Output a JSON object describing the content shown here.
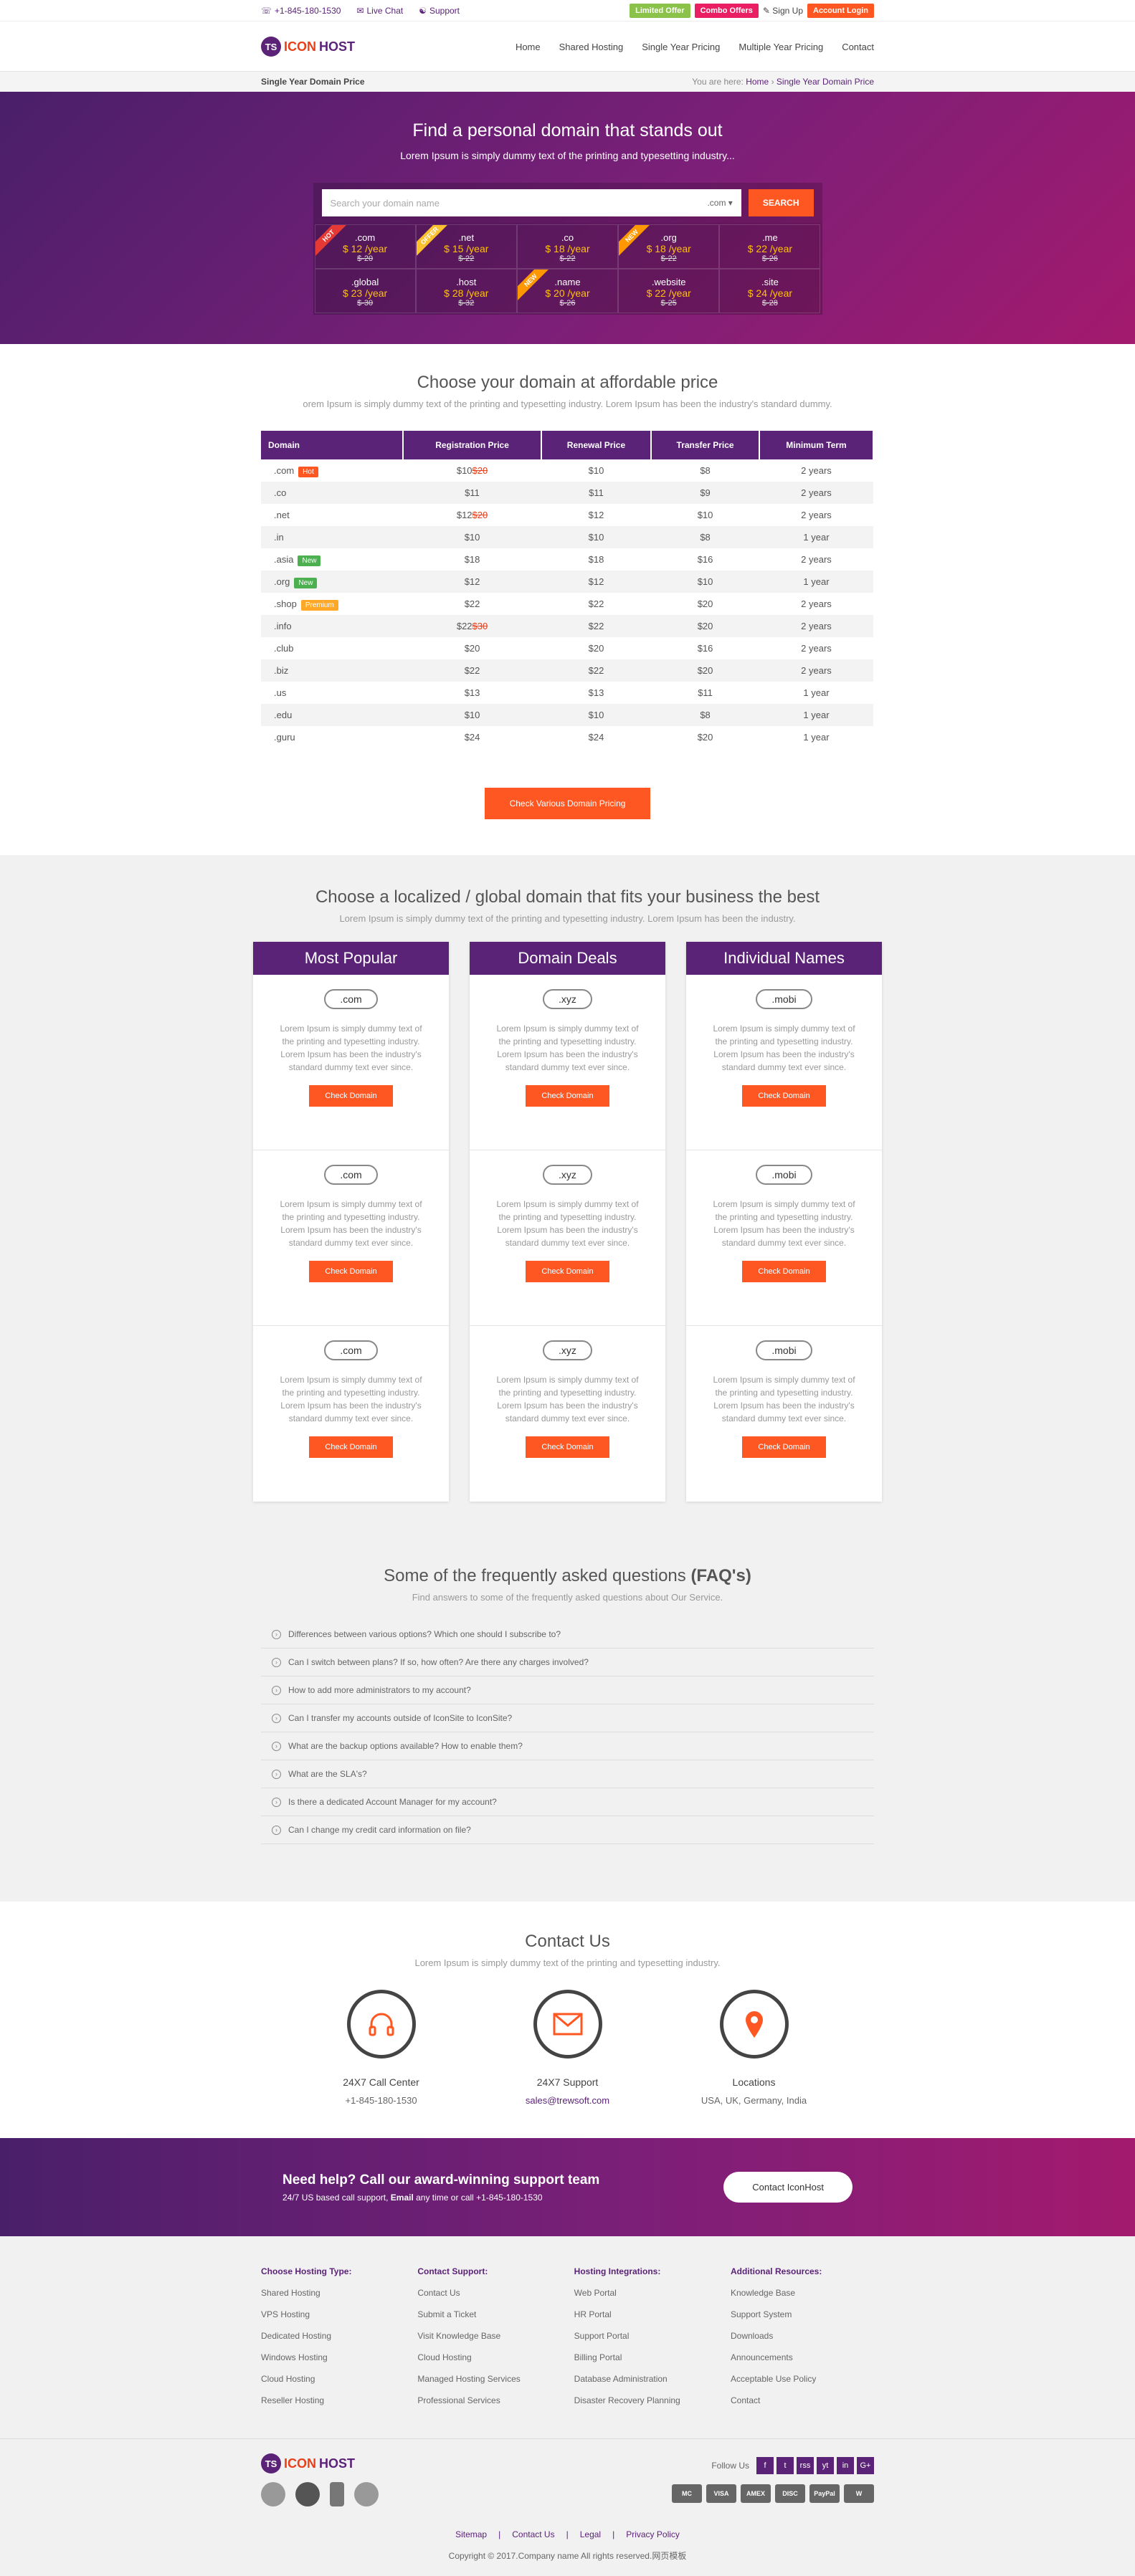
{
  "topbar": {
    "phone": "+1-845-180-1530",
    "live_chat": "Live Chat",
    "support": "Support",
    "limited_offer": "Limited Offer",
    "combo_offers": "Combo Offers",
    "sign_up": "Sign Up",
    "account_login": "Account Login"
  },
  "logo": {
    "mark": "TS",
    "part1": "ICON",
    "part2": "HOST"
  },
  "nav": [
    "Home",
    "Shared Hosting",
    "Single Year Pricing",
    "Multiple Year Pricing",
    "Contact"
  ],
  "crumb": {
    "title": "Single Year Domain Price",
    "prefix": "You are here:",
    "home": "Home",
    "sep": "›",
    "current": "Single Year Domain Price"
  },
  "hero": {
    "title": "Find a personal domain that stands out",
    "subtitle": "Lorem Ipsum is simply dummy text of the printing and typesetting industry...",
    "placeholder": "Search your domain name",
    "tld": ".com",
    "search": "SEARCH",
    "tlds": [
      {
        "name": ".com",
        "price": "$ 12 /year",
        "old": "$-20",
        "ribbon": "HOT"
      },
      {
        "name": ".net",
        "price": "$ 15 /year",
        "old": "$-22",
        "ribbon": "OFFER"
      },
      {
        "name": ".co",
        "price": "$ 18 /year",
        "old": "$-22",
        "ribbon": ""
      },
      {
        "name": ".org",
        "price": "$ 18 /year",
        "old": "$-22",
        "ribbon": "NEW"
      },
      {
        "name": ".me",
        "price": "$ 22 /year",
        "old": "$-26",
        "ribbon": ""
      },
      {
        "name": ".global",
        "price": "$ 23 /year",
        "old": "$-30",
        "ribbon": ""
      },
      {
        "name": ".host",
        "price": "$ 28 /year",
        "old": "$-32",
        "ribbon": ""
      },
      {
        "name": ".name",
        "price": "$ 20 /year",
        "old": "$-26",
        "ribbon": "NEW"
      },
      {
        "name": ".website",
        "price": "$ 22 /year",
        "old": "$-25",
        "ribbon": ""
      },
      {
        "name": ".site",
        "price": "$ 24 /year",
        "old": "$-28",
        "ribbon": ""
      }
    ]
  },
  "pricing": {
    "title": "Choose your domain at affordable price",
    "subtitle": "orem Ipsum is simply dummy text of the printing and typesetting industry. Lorem Ipsum has been the industry's standard dummy.",
    "headers": [
      "Domain",
      "Registration Price",
      "Renewal Price",
      "Transfer Price",
      "Minimum Term"
    ],
    "rows": [
      {
        "domain": ".com",
        "badge": "Hot",
        "reg": "$10",
        "old": "$20",
        "renew": "$10",
        "transfer": "$8",
        "term": "2 years"
      },
      {
        "domain": ".co",
        "badge": "",
        "reg": "$11",
        "old": "",
        "renew": "$11",
        "transfer": "$9",
        "term": "2 years"
      },
      {
        "domain": ".net",
        "badge": "",
        "reg": "$12",
        "old": "$20",
        "renew": "$12",
        "transfer": "$10",
        "term": "2 years"
      },
      {
        "domain": ".in",
        "badge": "",
        "reg": "$10",
        "old": "",
        "renew": "$10",
        "transfer": "$8",
        "term": "1 year"
      },
      {
        "domain": ".asia",
        "badge": "New",
        "reg": "$18",
        "old": "",
        "renew": "$18",
        "transfer": "$16",
        "term": "2 years"
      },
      {
        "domain": ".org",
        "badge": "New",
        "reg": "$12",
        "old": "",
        "renew": "$12",
        "transfer": "$10",
        "term": "1 year"
      },
      {
        "domain": ".shop",
        "badge": "Premium",
        "reg": "$22",
        "old": "",
        "renew": "$22",
        "transfer": "$20",
        "term": "2 years"
      },
      {
        "domain": ".info",
        "badge": "",
        "reg": "$22",
        "old": "$30",
        "renew": "$22",
        "transfer": "$20",
        "term": "2 years"
      },
      {
        "domain": ".club",
        "badge": "",
        "reg": "$20",
        "old": "",
        "renew": "$20",
        "transfer": "$16",
        "term": "2 years"
      },
      {
        "domain": ".biz",
        "badge": "",
        "reg": "$22",
        "old": "",
        "renew": "$22",
        "transfer": "$20",
        "term": "2 years"
      },
      {
        "domain": ".us",
        "badge": "",
        "reg": "$13",
        "old": "",
        "renew": "$13",
        "transfer": "$11",
        "term": "1 year"
      },
      {
        "domain": ".edu",
        "badge": "",
        "reg": "$10",
        "old": "",
        "renew": "$10",
        "transfer": "$8",
        "term": "1 year"
      },
      {
        "domain": ".guru",
        "badge": "",
        "reg": "$24",
        "old": "",
        "renew": "$24",
        "transfer": "$20",
        "term": "1 year"
      }
    ],
    "button": "Check Various Domain Pricing"
  },
  "localized": {
    "title": "Choose a localized / global domain that fits your business the best",
    "subtitle": "Lorem Ipsum is simply dummy text of the printing and typesetting industry. Lorem Ipsum has been the industry.",
    "columns": [
      {
        "title": "Most Popular",
        "tld": ".com"
      },
      {
        "title": "Domain Deals",
        "tld": ".xyz"
      },
      {
        "title": "Individual Names",
        "tld": ".mobi"
      }
    ],
    "text": "Lorem Ipsum is simply dummy text of the printing and typesetting industry. Lorem Ipsum has been the industry's standard dummy text ever since.",
    "button": "Check Domain"
  },
  "faq": {
    "title": "Some of the frequently asked questions",
    "title_bold": "(FAQ's)",
    "subtitle": "Find answers to some of the frequently asked questions about Our Service.",
    "questions": [
      "Differences between various options? Which one should I subscribe to?",
      "Can I switch between plans? If so, how often? Are there any charges involved?",
      "How to add more administrators to my account?",
      "Can I transfer my accounts outside of IconSite to IconSite?",
      "What are the backup options available? How to enable them?",
      "What are the SLA's?",
      "Is there a dedicated Account Manager for my account?",
      "Can I change my credit card information on file?"
    ]
  },
  "contact": {
    "title": "Contact Us",
    "subtitle": "Lorem Ipsum is simply dummy text of the printing and typesetting industry.",
    "items": [
      {
        "title": "24X7 Call Center",
        "value": "+1-845-180-1530",
        "icon": "headphones-icon"
      },
      {
        "title": "24X7 Support",
        "value": "sales@trewsoft.com",
        "icon": "envelope-icon"
      },
      {
        "title": "Locations",
        "value": "USA, UK, Germany, India",
        "icon": "map-pin-icon"
      }
    ]
  },
  "help": {
    "title": "Need help? Call our award-winning support team",
    "text_a": "24/7 US based call support,",
    "text_b": "Email",
    "text_c": "any time or call +1-845-180-1530",
    "button": "Contact IconHost"
  },
  "footer": {
    "cols": [
      {
        "title": "Choose Hosting Type:",
        "links": [
          "Shared Hosting",
          "VPS Hosting",
          "Dedicated Hosting",
          "Windows Hosting",
          "Cloud Hosting",
          "Reseller Hosting"
        ]
      },
      {
        "title": "Contact Support:",
        "links": [
          "Contact Us",
          "Submit a Ticket",
          "Visit Knowledge Base",
          "Cloud Hosting",
          "Managed Hosting Services",
          "Professional Services"
        ]
      },
      {
        "title": "Hosting Integrations:",
        "links": [
          "Web Portal",
          "HR Portal",
          "Support Portal",
          "Billing Portal",
          "Database Administration",
          "Disaster Recovery Planning"
        ]
      },
      {
        "title": "Additional Resources:",
        "links": [
          "Knowledge Base",
          "Support System",
          "Downloads",
          "Announcements",
          "Acceptable Use Policy",
          "Contact"
        ]
      }
    ],
    "follow": "Follow Us",
    "socials": [
      "f",
      "t",
      "rss",
      "yt",
      "in",
      "G+"
    ],
    "cards": [
      "MC",
      "VISA",
      "AMEX",
      "DISC",
      "PayPal",
      "W"
    ],
    "links": [
      "Sitemap",
      "Contact Us",
      "Legal",
      "Privacy Policy"
    ],
    "copyright": "Copyright © 2017.Company name All rights reserved.网页模板"
  },
  "colors": {
    "purple": "#5b2378",
    "orange": "#ff5722",
    "green": "#8bc34a",
    "pink": "#e91e63"
  }
}
